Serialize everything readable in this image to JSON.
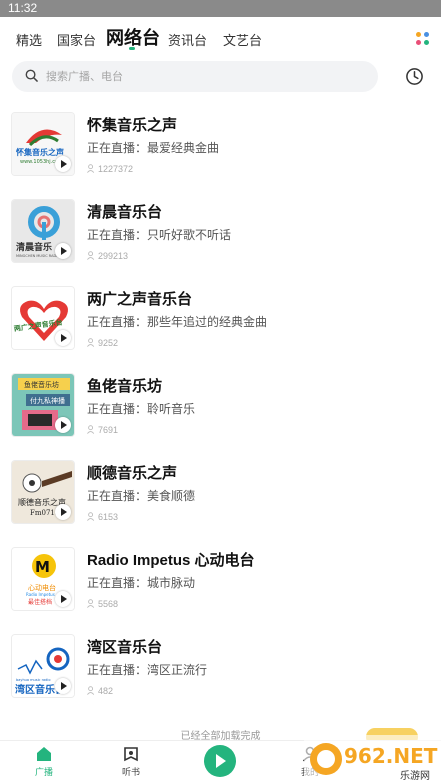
{
  "status_bar": {
    "time": "11:32"
  },
  "tabs": [
    {
      "label": "精选"
    },
    {
      "label": "国家台"
    },
    {
      "label": "网络台"
    },
    {
      "label": "资讯台"
    },
    {
      "label": "文艺台"
    }
  ],
  "active_tab": "网络台",
  "search": {
    "placeholder": "搜索广播、电台"
  },
  "stations": [
    {
      "name": "怀集音乐之声",
      "now_playing": "正在直播：最爱经典金曲",
      "listeners": "1227372"
    },
    {
      "name": "清晨音乐台",
      "now_playing": "正在直播：只听好歌不听话",
      "listeners": "299213"
    },
    {
      "name": "两广之声音乐台",
      "now_playing": "正在直播：那些年追过的经典金曲",
      "listeners": "9252"
    },
    {
      "name": "鱼佬音乐坊",
      "now_playing": "正在直播：聆听音乐",
      "listeners": "7691"
    },
    {
      "name": "顺德音乐之声",
      "now_playing": "正在直播：美食顺德",
      "listeners": "6153"
    },
    {
      "name": "Radio Impetus 心动电台",
      "now_playing": "正在直播：城市脉动",
      "listeners": "5568"
    },
    {
      "name": "湾区音乐台",
      "now_playing": "正在直播：湾区正流行",
      "listeners": "482"
    }
  ],
  "footer_text": "已经全部加载完成",
  "bottom_nav": [
    {
      "label": "广播"
    },
    {
      "label": "听书"
    },
    {
      "label": ""
    },
    {
      "label": "我的"
    }
  ],
  "thumb_text": {
    "huaiji": "怀集音乐之声",
    "huaiji_url": "www.1053hj.com",
    "qingchen": "清晨音乐",
    "qingchen_sub": "MINGCHEN MUSIC RADIO",
    "liangguang": "两广之声音乐台",
    "yulao_top": "鱼佬音乐坊",
    "yulao_mid": "付九私神播",
    "shunde": "顺德音乐之声",
    "shunde_fm": "Fm0713",
    "impetus": "心动电台",
    "impetus_en": "Radio Impetus",
    "impetus_sub": "最佳搭档",
    "wanqu": "湾区音乐台",
    "wanqu_en": "bayhua music radio"
  },
  "watermark": {
    "brand": "962.NET",
    "sub": "乐游网"
  },
  "colors": {
    "accent": "#24b47e",
    "status_bar": "#8a8a8a"
  }
}
